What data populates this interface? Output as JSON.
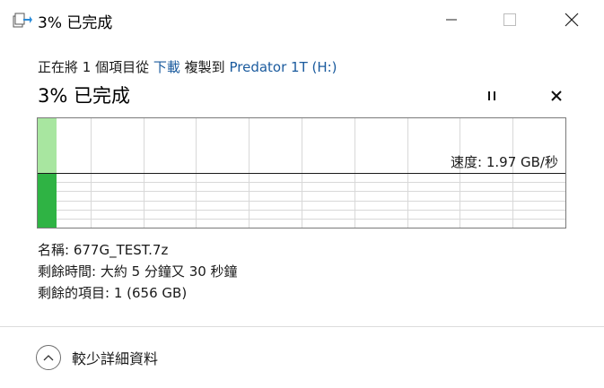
{
  "window": {
    "title": "3% 已完成",
    "icon": "file-copy-icon",
    "controls": [
      "minimize-icon",
      "maximize-icon",
      "close-icon"
    ]
  },
  "copy": {
    "desc_prefix": "正在將 1 個項目從",
    "source": "下載",
    "desc_middle": "複製到",
    "destination": "Predator 1T (H:)",
    "status": "3% 已完成",
    "progress_percent": 3,
    "pause_icon": "pause-icon",
    "cancel_icon": "cancel-icon"
  },
  "graph": {
    "speed_text": "速度: 1.97 GB/秒",
    "completed_fraction": 0.036,
    "speed_line_fraction": 0.5,
    "colors": {
      "done_fill": "#2fb344",
      "done_fill_light": "#a8e6a0",
      "speed_line": "#1a1a1a",
      "grid": "#d8d8d8"
    }
  },
  "details": {
    "name_label": "名稱:",
    "name_value": "677G_TEST.7z",
    "time_label": "剩餘時間:",
    "time_value": "大約 5 分鐘又 30 秒鐘",
    "items_label": "剩餘的項目:",
    "items_value": "1 (656 GB)"
  },
  "footer": {
    "toggle_label": "較少詳細資料",
    "toggle_icon": "chevron-up-icon"
  }
}
